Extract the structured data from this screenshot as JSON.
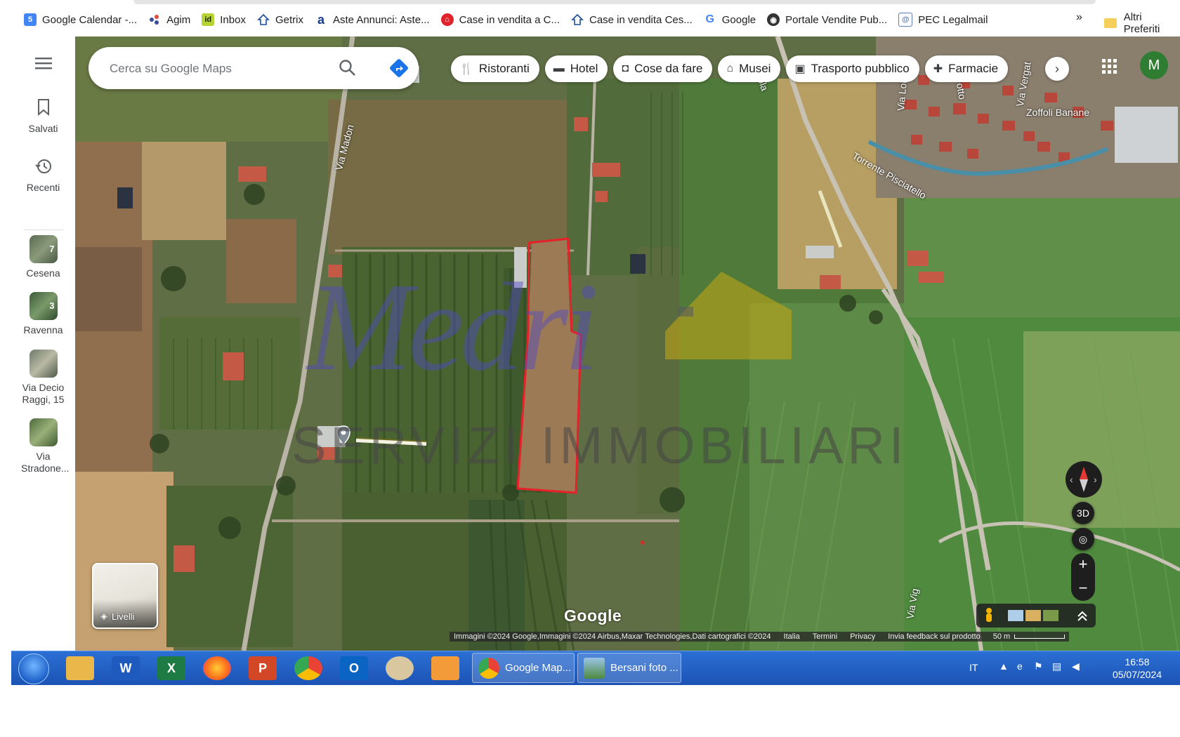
{
  "bookmarks": [
    {
      "label": "Google Calendar -...",
      "icon": "calendar-icon",
      "color": "#4285f4"
    },
    {
      "label": "Agim",
      "icon": "agim-icon",
      "color": "#3b4b9e"
    },
    {
      "label": "Inbox",
      "icon": "idealista-icon",
      "color": "#b6d334"
    },
    {
      "label": "Getrix",
      "icon": "house-icon",
      "color": "#1a4f9c"
    },
    {
      "label": "Aste Annunci: Aste...",
      "icon": "aste-icon",
      "color": "#1a3c8c"
    },
    {
      "label": "Case in vendita a C...",
      "icon": "immobiliare-icon",
      "color": "#e0232a"
    },
    {
      "label": "Case in vendita Ces...",
      "icon": "house-icon",
      "color": "#1a4f9c"
    },
    {
      "label": "Google",
      "icon": "google-icon",
      "color": "#4285f4"
    },
    {
      "label": "Portale Vendite Pub...",
      "icon": "globe-icon",
      "color": "#333333"
    },
    {
      "label": "PEC Legalmail",
      "icon": "legalmail-icon",
      "color": "#5a7fb8"
    }
  ],
  "bookmarks_more": "»",
  "bookmarks_other": "Altri Preferiti",
  "rail": {
    "menu_icon": "menu-icon",
    "saved": "Salvati",
    "recent": "Recenti",
    "places": [
      {
        "label": "Cesena",
        "count": "7"
      },
      {
        "label": "Ravenna",
        "count": "3"
      },
      {
        "label": "Via Decio Raggi, 15",
        "count": ""
      },
      {
        "label": "Via Stradone...",
        "count": ""
      }
    ]
  },
  "search": {
    "placeholder": "Cerca su Google Maps"
  },
  "chips": [
    {
      "label": "Ristoranti",
      "icon": "fork-knife-icon"
    },
    {
      "label": "Hotel",
      "icon": "bed-icon"
    },
    {
      "label": "Cose da fare",
      "icon": "camera-icon"
    },
    {
      "label": "Musei",
      "icon": "museum-icon"
    },
    {
      "label": "Trasporto pubblico",
      "icon": "bus-icon"
    },
    {
      "label": "Farmacie",
      "icon": "pharmacy-icon"
    }
  ],
  "avatar_letter": "M",
  "avatar_color": "#2f7d32",
  "map": {
    "labels": {
      "via_madonna": "Via Madon",
      "torrente": "Torrente Pisciatello",
      "zoffoli": "Zoffoli Banane",
      "via_vergat": "Via Vergat",
      "via_lolano": "Via Lolano",
      "via_vig": "Via Vig",
      "ola": "ola",
      "otto": "otto"
    },
    "watermark_script": "Medri",
    "watermark_sub": "SERVIZI IMMOBILIARI",
    "layers_label": "Livelli",
    "google_logo": "Google",
    "attribution": "Immagini ©2024 Google,Immagini ©2024 Airbus,Maxar Technologies,Dati cartografici ©2024",
    "links": [
      "Italia",
      "Termini",
      "Privacy",
      "Invia feedback sul prodotto"
    ],
    "scale": "50 m",
    "btn_3d": "3D",
    "zoom_in": "+",
    "zoom_out": "−",
    "parcel_color": "#e8202a"
  },
  "taskbar": {
    "apps": [
      {
        "name": "explorer",
        "label": "",
        "color": "#e9b74a"
      },
      {
        "name": "word",
        "label": "W",
        "color": "#1f5bbf"
      },
      {
        "name": "excel",
        "label": "X",
        "color": "#1e7b43"
      },
      {
        "name": "firefox",
        "label": "",
        "color": "#ff8a1c"
      },
      {
        "name": "powerpoint",
        "label": "P",
        "color": "#d24726"
      },
      {
        "name": "chrome",
        "label": "",
        "color": "#34a853"
      },
      {
        "name": "outlook",
        "label": "O",
        "color": "#0a64c4"
      },
      {
        "name": "paint",
        "label": "",
        "color": "#d9c7a0"
      },
      {
        "name": "media",
        "label": "",
        "color": "#f29b38"
      }
    ],
    "tasks": [
      "Google Map...",
      "Bersani foto ..."
    ],
    "lang": "IT",
    "time": "16:58",
    "date": "05/07/2024"
  }
}
